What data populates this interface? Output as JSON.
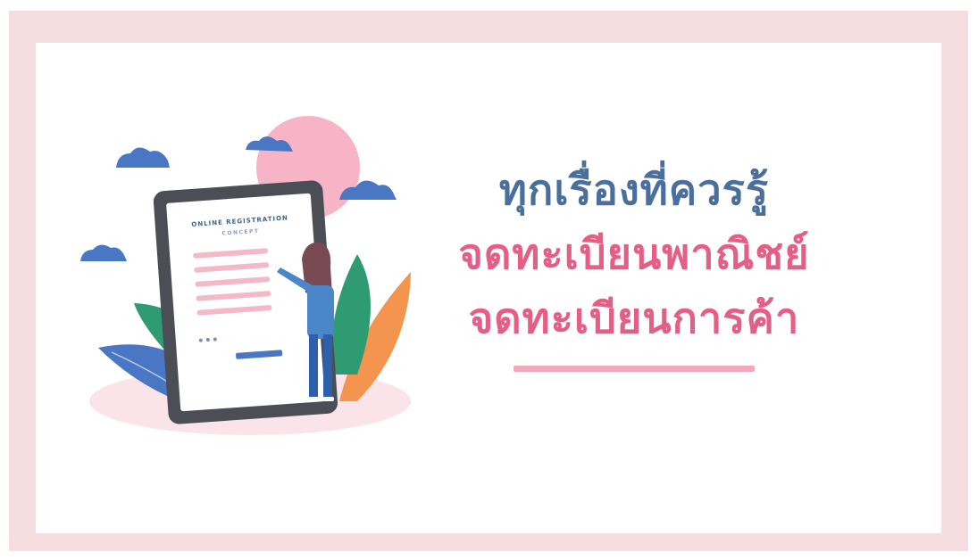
{
  "headline": {
    "line1": "ทุกเรื่องที่ควรรู้",
    "line2": "จดทะเบียนพาณิชย์",
    "line3": "จดทะเบียนการค้า"
  },
  "tablet": {
    "title": "ONLINE REGISTRATION",
    "subtitle": "CONCEPT"
  },
  "colors": {
    "frame": "#f5dde0",
    "headline_blue": "#4b6f9c",
    "headline_pink": "#e45f86",
    "underline": "#f1a9be"
  }
}
